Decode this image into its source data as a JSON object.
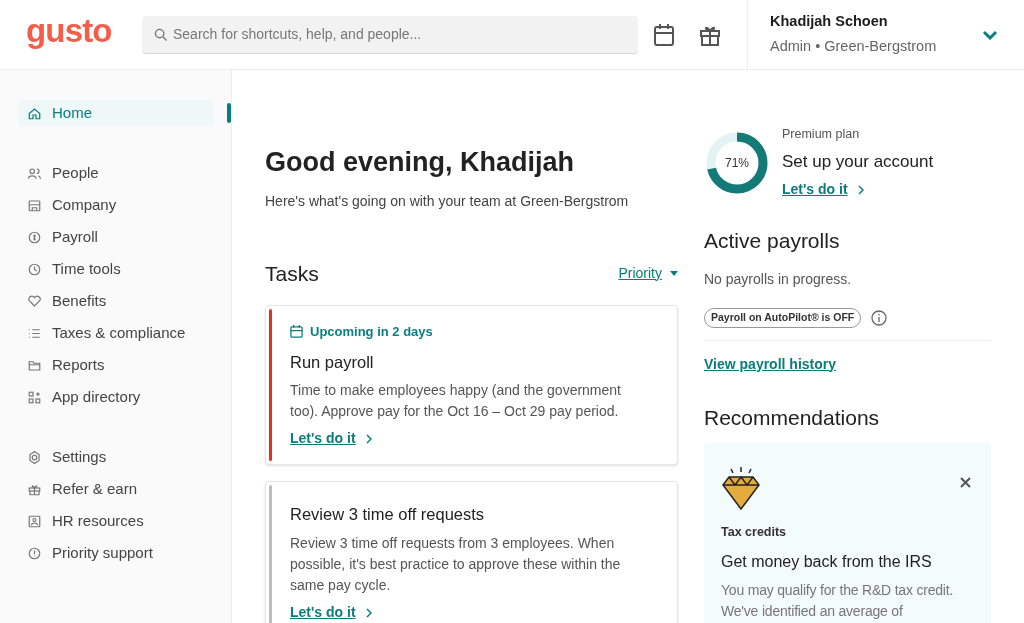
{
  "header": {
    "logo": "gusto",
    "search": {
      "placeholder": "Search for shortcuts, help, and people..."
    },
    "user": {
      "name": "Khadijah Schoen",
      "role": "Admin • Green-Bergstrom"
    }
  },
  "sidebar": {
    "groups": [
      [
        {
          "label": "Home",
          "selected": true
        }
      ],
      [
        {
          "label": "People",
          "selected": false
        },
        {
          "label": "Company",
          "selected": false
        },
        {
          "label": "Payroll",
          "selected": false
        },
        {
          "label": "Time tools",
          "selected": false
        },
        {
          "label": "Benefits",
          "selected": false
        },
        {
          "label": "Taxes & compliance",
          "selected": false
        },
        {
          "label": "Reports",
          "selected": false
        },
        {
          "label": "App directory",
          "selected": false
        }
      ],
      [
        {
          "label": "Settings",
          "selected": false
        },
        {
          "label": "Refer & earn",
          "selected": false
        },
        {
          "label": "HR resources",
          "selected": false
        },
        {
          "label": "Priority support",
          "selected": false
        }
      ]
    ]
  },
  "greeting": {
    "title": "Good evening, Khadijah",
    "subtitle": "Here's what's going on with your team at Green-Bergstrom"
  },
  "tasks": {
    "title": "Tasks",
    "sort": "Priority",
    "items": [
      {
        "color": "#e0321e",
        "badge": "Upcoming in 2 days",
        "title": "Run payroll",
        "text": "Time to make employees happy (and the government too). Approve pay for the Oct 16 – Oct 29 pay period.",
        "link": "Let's do it"
      },
      {
        "color": "#bdbdbd",
        "title": "Review 3 time off requests",
        "text": "Review 3 time off requests from 3 employees. When possible, it's best practice to approve these within the same pay cycle.",
        "link": "Let's do it"
      }
    ]
  },
  "setup": {
    "level": 0.71,
    "percent": "71%",
    "plan": "Premium plan",
    "title": "Set up your account",
    "link": "Let's do it"
  },
  "active_payrolls": {
    "title": "Active payrolls",
    "status": "No payrolls in progress.",
    "autopilot": "Payroll on AutoPilot® is OFF",
    "link": "View payroll history"
  },
  "recommendations": {
    "title": "Recommendations",
    "card": {
      "category": "Tax credits",
      "title": "Get money back from the IRS",
      "text": "You may qualify for the R&D tax credit. We've identified an average of"
    }
  }
}
